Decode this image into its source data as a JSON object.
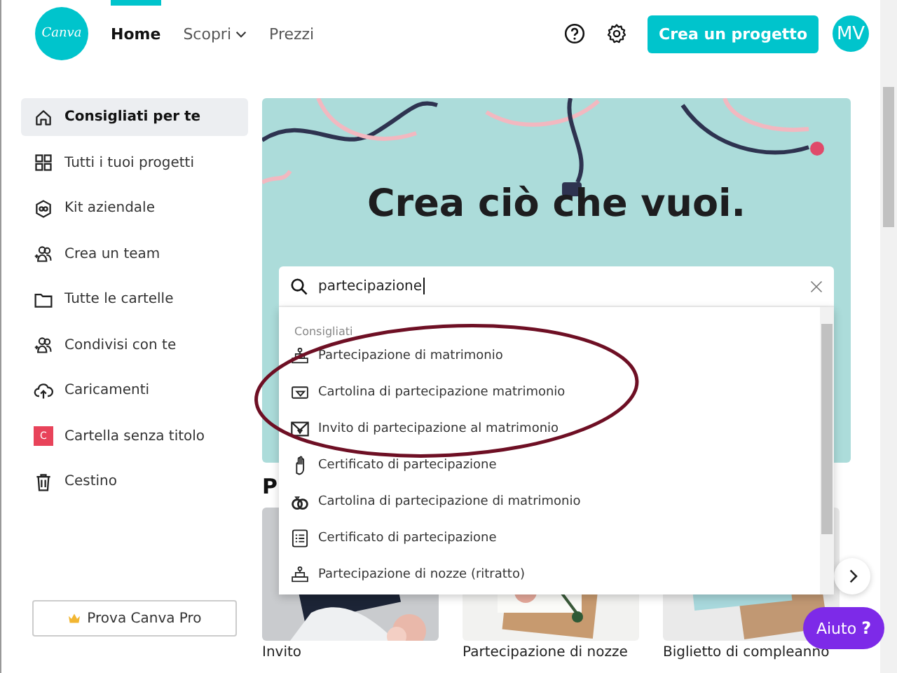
{
  "header": {
    "logo": "Canva",
    "nav": [
      {
        "label": "Home",
        "selected": true,
        "has_menu": false
      },
      {
        "label": "Scopri",
        "selected": false,
        "has_menu": true
      },
      {
        "label": "Prezzi",
        "selected": false,
        "has_menu": false
      }
    ],
    "create_button": "Crea un progetto",
    "avatar": "MV"
  },
  "sidebar": {
    "items": [
      {
        "label": "Consigliati per te",
        "selected": true
      },
      {
        "label": "Tutti i tuoi progetti",
        "selected": false
      },
      {
        "label": "Kit aziendale",
        "selected": false
      },
      {
        "label": "Crea un team",
        "selected": false
      },
      {
        "label": "Tutte le cartelle",
        "selected": false
      },
      {
        "label": "Condivisi con te",
        "selected": false
      },
      {
        "label": "Caricamenti",
        "selected": false
      },
      {
        "label": "Cartella senza titolo",
        "selected": false,
        "badge": "C",
        "color": "#e8435a"
      },
      {
        "label": "Cestino",
        "selected": false
      }
    ],
    "pro_button": "Prova Canva Pro"
  },
  "hero": {
    "title": "Crea ciò che vuoi.",
    "search": {
      "value": "partecipazione"
    }
  },
  "suggestions": {
    "heading": "Consigliati",
    "items": [
      "Partecipazione di matrimonio",
      "Cartolina di partecipazione matrimonio",
      "Invito di partecipazione al matrimonio",
      "Certificato di partecipazione",
      "Cartolina di partecipazione di matrimonio",
      "Certificato di partecipazione",
      "Partecipazione di nozze (ritratto)"
    ]
  },
  "section_heading": "P",
  "cards": [
    {
      "label": "Invito"
    },
    {
      "label": "Partecipazione di nozze"
    },
    {
      "label": "Biglietto di compleanno"
    }
  ],
  "help_button": {
    "label": "Aiuto",
    "icon": "?"
  }
}
